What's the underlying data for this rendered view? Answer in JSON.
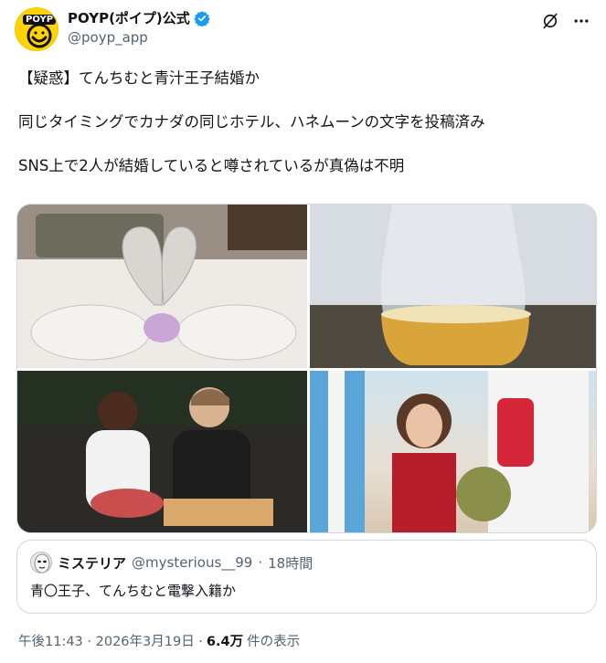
{
  "author": {
    "display_name": "POYP(ポイプ)公式",
    "handle": "@poyp_app",
    "avatar_text": "POYP",
    "brand_color": "#ffd400",
    "verified_color": "#1d9bf0"
  },
  "header_icons": [
    "grok-icon",
    "more-icon"
  ],
  "tweet": {
    "text": "【疑惑】てんちむと青汁王子結婚か\n\n同じタイミングでカナダの同じホテル、ハネムーンの文字を投稿済み\n\nSNS上で2人が結婚していると噂されているが真偽は不明"
  },
  "quote": {
    "display_name": "ミステリア",
    "handle": "@mysterious__99",
    "separator": "·",
    "time": "18時間",
    "text": "青〇王子、てんちむと電撃入籍か"
  },
  "footer": {
    "timestamp": "午後11:43 · 2026年3月19日 ·",
    "views_count": "6.4万",
    "views_label": "件の表示"
  }
}
